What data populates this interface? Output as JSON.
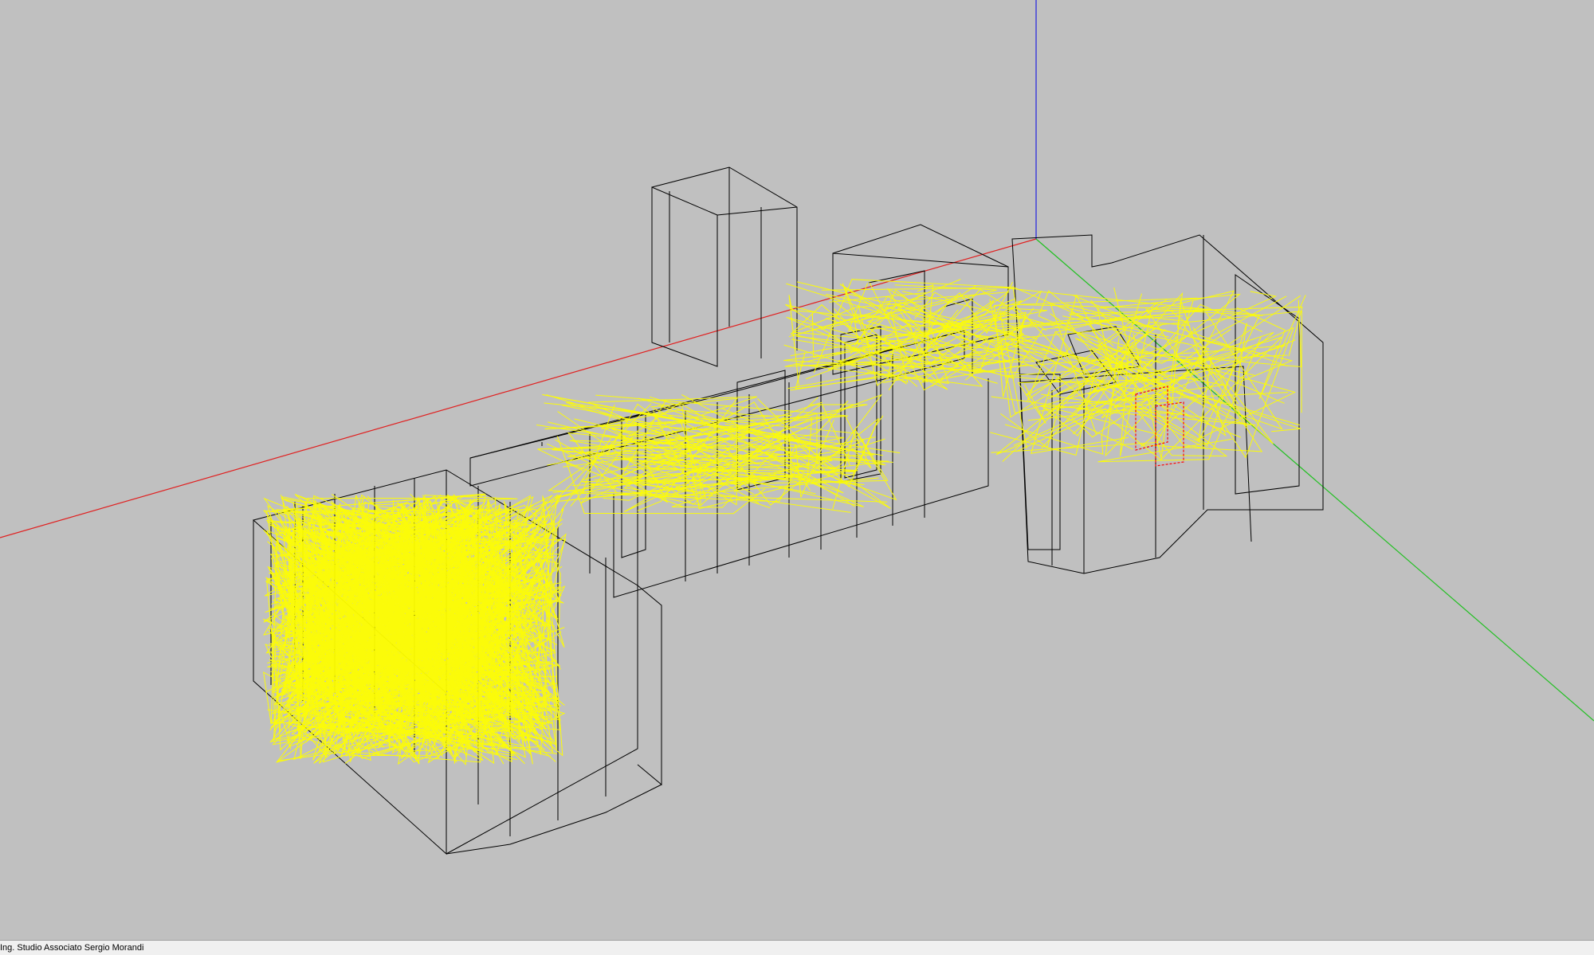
{
  "viewport": {
    "background_color": "#c0c0c0",
    "axis_colors": {
      "x_axis": "#e02020",
      "y_axis": "#20c020",
      "z_axis": "#2020e0"
    },
    "wireframe_color": "#000000",
    "ray_color": "#ffff00",
    "marker_color": "#ff0000"
  },
  "statusbar": {
    "text": "Ing. Studio Associato Sergio Morandi"
  }
}
